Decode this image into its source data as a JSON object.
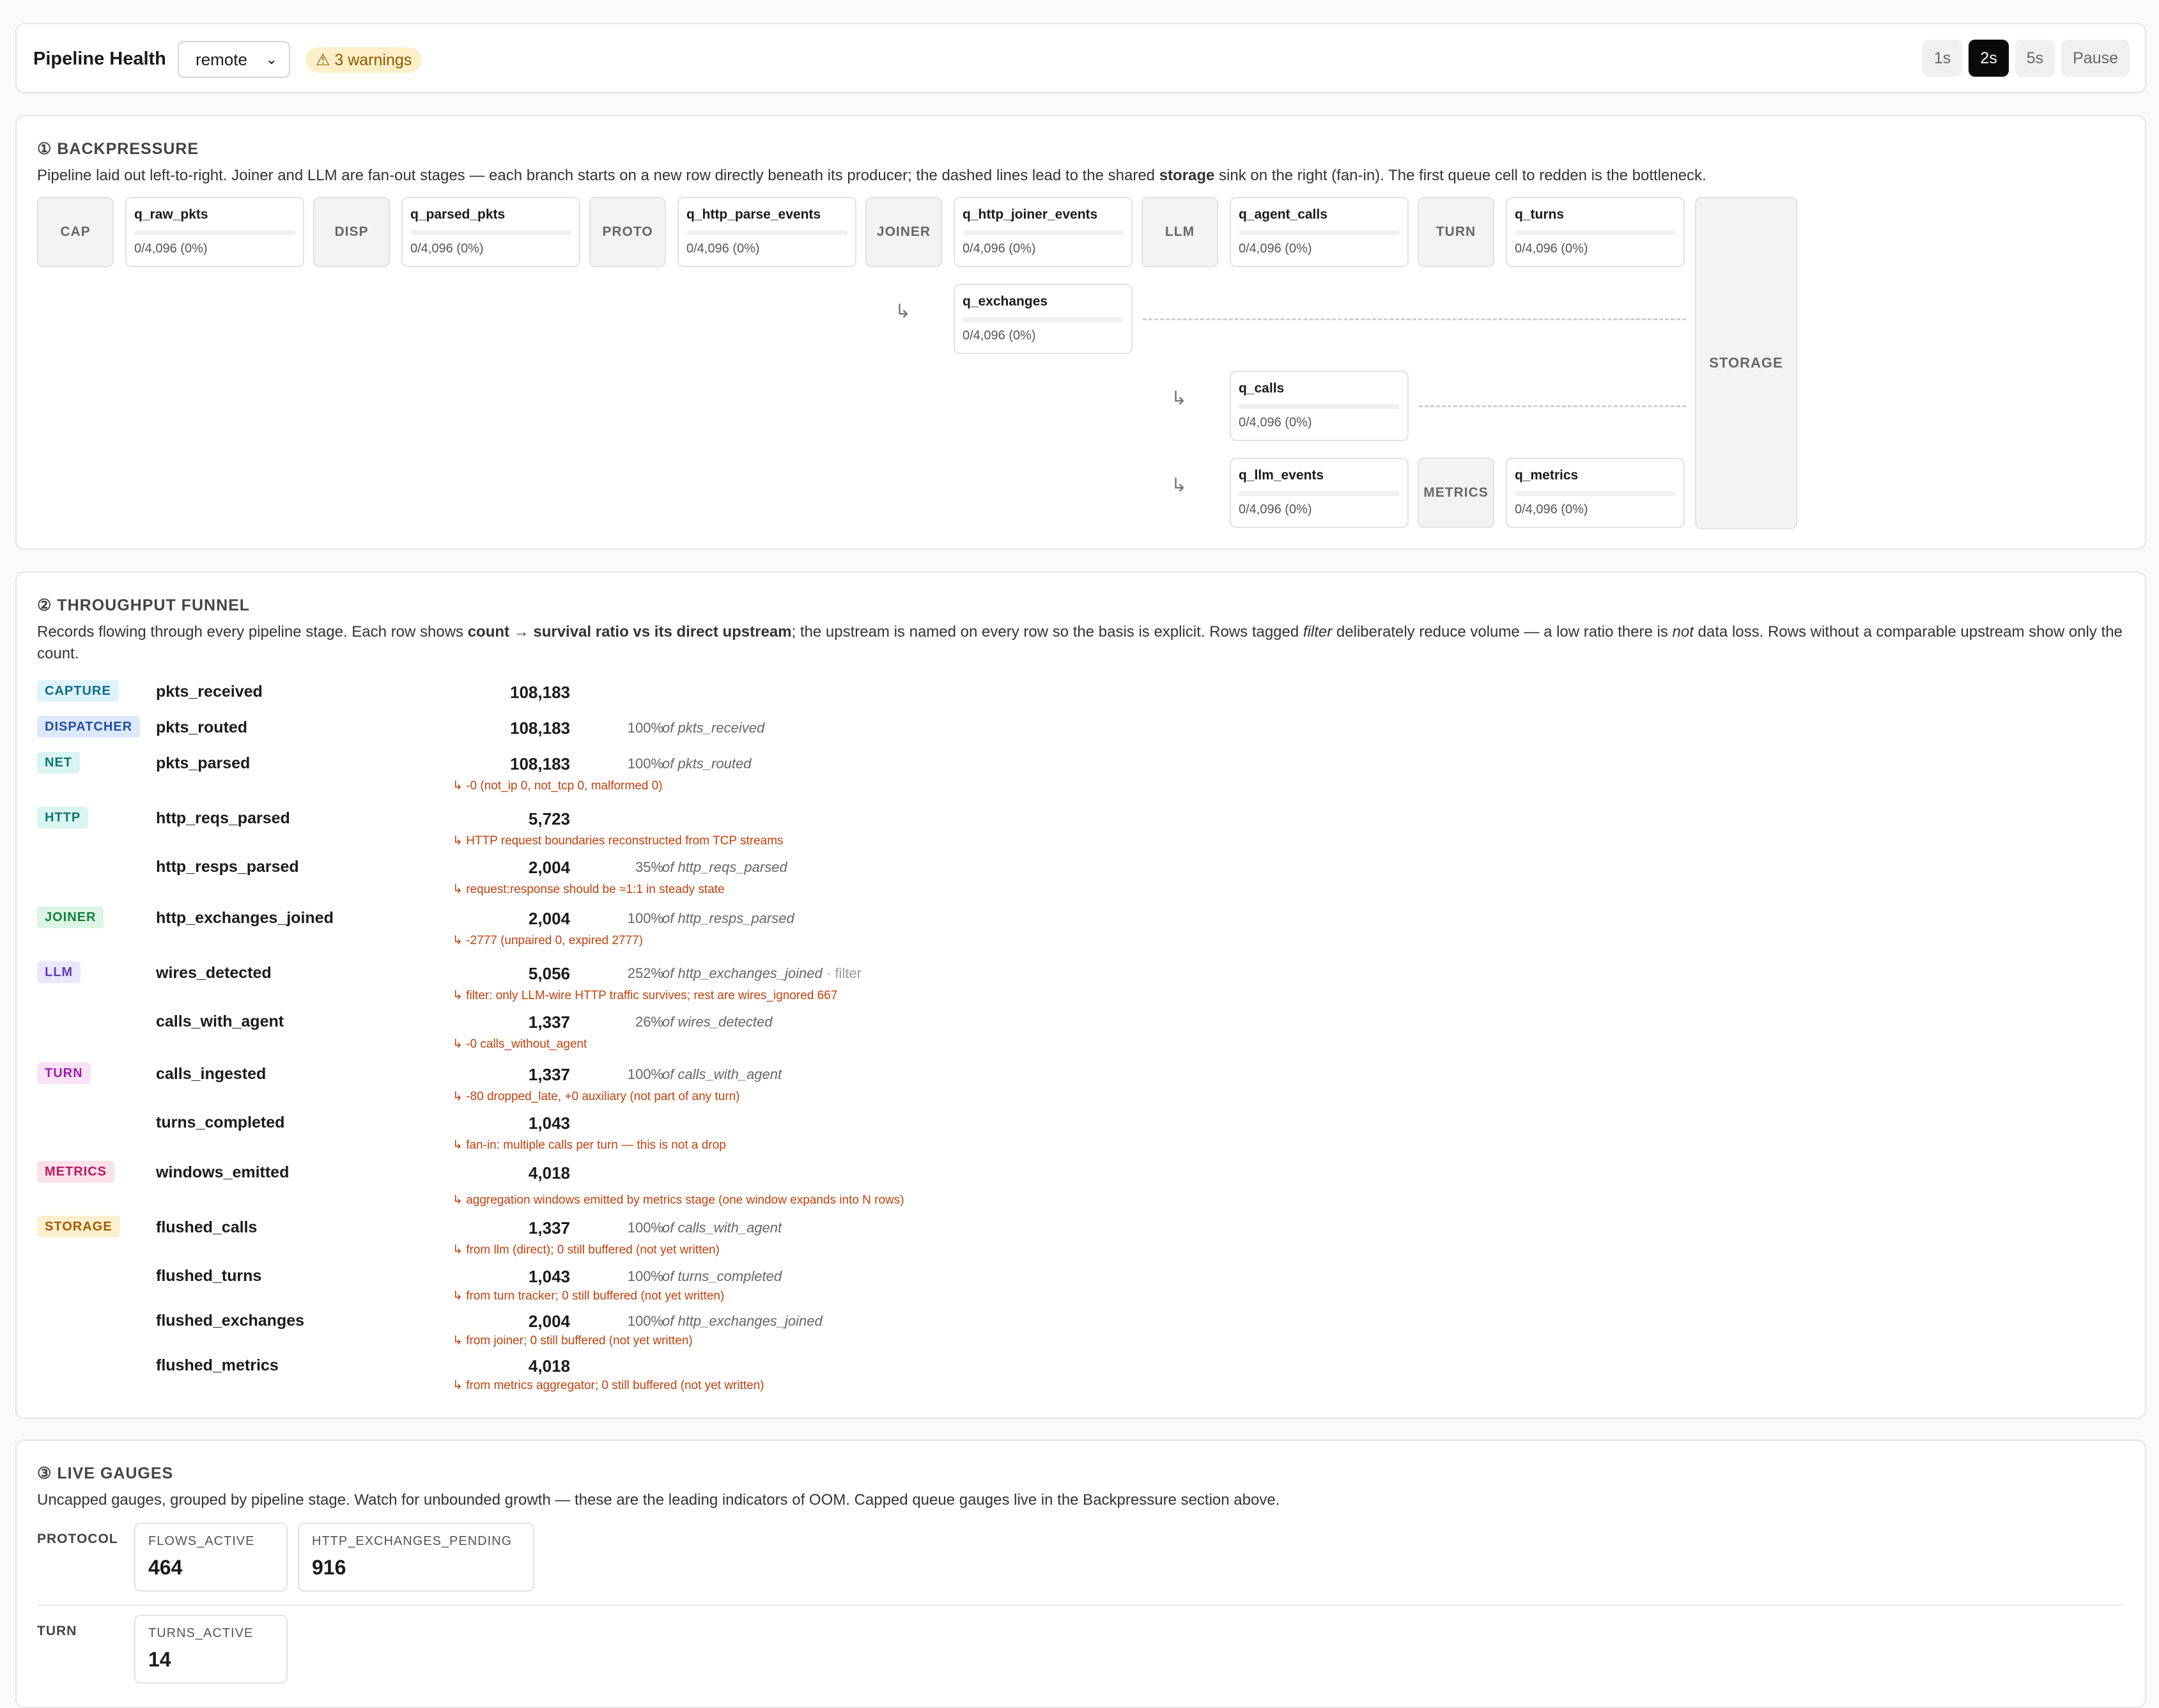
{
  "header": {
    "title": "Pipeline Health",
    "env": "remote",
    "warnings": "⚠ 3 warnings",
    "rates": [
      "1s",
      "2s",
      "5s",
      "Pause"
    ],
    "active_rate": "2s"
  },
  "backpressure": {
    "title": "① BACKPRESSURE",
    "desc_a": "Pipeline laid out left-to-right. Joiner and LLM are fan-out stages — each branch starts on a new row directly beneath its producer; the dashed lines lead to the shared ",
    "desc_b": "storage",
    "desc_c": " sink on the right (fan-in). The first queue cell to redden is the bottleneck.",
    "stages": [
      "CAP",
      "DISP",
      "PROTO",
      "JOINER",
      "LLM",
      "TURN",
      "METRICS"
    ],
    "storage": "STORAGE",
    "queues": [
      {
        "name": "q_raw_pkts",
        "value": "0/4,096 (0%)",
        "fill": 0
      },
      {
        "name": "q_parsed_pkts",
        "value": "0/4,096 (0%)",
        "fill": 0
      },
      {
        "name": "q_http_parse_events",
        "value": "0/4,096 (0%)",
        "fill": 0
      },
      {
        "name": "q_http_joiner_events",
        "value": "0/4,096 (0%)",
        "fill": 0
      },
      {
        "name": "q_agent_calls",
        "value": "0/4,096 (0%)",
        "fill": 0
      },
      {
        "name": "q_turns",
        "value": "0/4,096 (0%)",
        "fill": 0
      },
      {
        "name": "q_exchanges",
        "value": "0/4,096 (0%)",
        "fill": 0
      },
      {
        "name": "q_calls",
        "value": "0/4,096 (0%)",
        "fill": 0
      },
      {
        "name": "q_llm_events",
        "value": "0/4,096 (0%)",
        "fill": 0
      },
      {
        "name": "q_metrics",
        "value": "0/4,096 (0%)",
        "fill": 0
      }
    ],
    "branch_arrow": "↳"
  },
  "funnel": {
    "title": "② THROUGHPUT FUNNEL",
    "desc_a": "Records flowing through every pipeline stage. Each row shows ",
    "desc_b": "count → survival ratio vs its direct upstream",
    "desc_c": "; the upstream is named on every row so the basis is explicit. Rows tagged ",
    "desc_d": "filter",
    "desc_e": " deliberately reduce volume — a low ratio there is ",
    "desc_f": "not",
    "desc_g": " data loss. Rows without a comparable upstream show only the count.",
    "tags": {
      "capture": "CAPTURE",
      "dispatcher": "DISPATCHER",
      "net": "NET",
      "http": "HTTP",
      "joiner": "JOINER",
      "llm": "LLM",
      "turn": "TURN",
      "metrics": "METRICS",
      "storage": "STORAGE"
    },
    "tag_colors": {
      "capture": {
        "bg": "#dff3fb",
        "fg": "#0b6d8a"
      },
      "dispatcher": {
        "bg": "#dde8fb",
        "fg": "#1f4fa3"
      },
      "net": {
        "bg": "#d9f5f3",
        "fg": "#0f766e"
      },
      "http": {
        "bg": "#d9f5f0",
        "fg": "#0f766e"
      },
      "joiner": {
        "bg": "#dcf5e5",
        "fg": "#15803d"
      },
      "llm": {
        "bg": "#ebe6fb",
        "fg": "#5b3fb6"
      },
      "turn": {
        "bg": "#f8e3f6",
        "fg": "#a21caf"
      },
      "metrics": {
        "bg": "#fbe1ea",
        "fg": "#be185d"
      },
      "storage": {
        "bg": "#fdf0cf",
        "fg": "#a35a00"
      }
    },
    "rows": [
      {
        "name": "pkts_received",
        "count": "108,183",
        "ratio": "",
        "basis": "",
        "flag": "",
        "note": ""
      },
      {
        "name": "pkts_routed",
        "count": "108,183",
        "ratio": "100%",
        "basis": "of pkts_received",
        "flag": "",
        "note": ""
      },
      {
        "name": "pkts_parsed",
        "count": "108,183",
        "ratio": "100%",
        "basis": "of pkts_routed",
        "flag": "",
        "note": "↳ -0 (not_ip 0, not_tcp 0, malformed 0)"
      },
      {
        "name": "http_reqs_parsed",
        "count": "5,723",
        "ratio": "",
        "basis": "",
        "flag": "",
        "note": "↳ HTTP request boundaries reconstructed from TCP streams"
      },
      {
        "name": "http_resps_parsed",
        "count": "2,004",
        "ratio": "35%",
        "basis": "of http_reqs_parsed",
        "flag": "",
        "note": "↳ request:response should be ≈1:1 in steady state"
      },
      {
        "name": "http_exchanges_joined",
        "count": "2,004",
        "ratio": "100%",
        "basis": "of http_resps_parsed",
        "flag": "",
        "note": "↳ -2777 (unpaired 0, expired 2777)"
      },
      {
        "name": "wires_detected",
        "count": "5,056",
        "ratio": "252%",
        "basis": "of http_exchanges_joined",
        "flag": " · filter",
        "note": "↳ filter: only LLM-wire HTTP traffic survives; rest are wires_ignored 667"
      },
      {
        "name": "calls_with_agent",
        "count": "1,337",
        "ratio": "26%",
        "basis": "of wires_detected",
        "flag": "",
        "note": "↳ -0 calls_without_agent"
      },
      {
        "name": "calls_ingested",
        "count": "1,337",
        "ratio": "100%",
        "basis": "of calls_with_agent",
        "flag": "",
        "note": "↳ -80 dropped_late, +0 auxiliary (not part of any turn)"
      },
      {
        "name": "turns_completed",
        "count": "1,043",
        "ratio": "",
        "basis": "",
        "flag": "",
        "note": "↳ fan-in: multiple calls per turn — this is not a drop"
      },
      {
        "name": "windows_emitted",
        "count": "4,018",
        "ratio": "",
        "basis": "",
        "flag": "",
        "note": "↳ aggregation windows emitted by metrics stage (one window expands into N rows)"
      },
      {
        "name": "flushed_calls",
        "count": "1,337",
        "ratio": "100%",
        "basis": "of calls_with_agent",
        "flag": "",
        "note": "↳ from llm (direct); 0 still buffered (not yet written)"
      },
      {
        "name": "flushed_turns",
        "count": "1,043",
        "ratio": "100%",
        "basis": "of turns_completed",
        "flag": "",
        "note": "↳ from turn tracker; 0 still buffered (not yet written)"
      },
      {
        "name": "flushed_exchanges",
        "count": "2,004",
        "ratio": "100%",
        "basis": "of http_exchanges_joined",
        "flag": "",
        "note": "↳ from joiner; 0 still buffered (not yet written)"
      },
      {
        "name": "flushed_metrics",
        "count": "4,018",
        "ratio": "",
        "basis": "",
        "flag": "",
        "note": "↳ from metrics aggregator; 0 still buffered (not yet written)"
      }
    ]
  },
  "gauges": {
    "title": "③ LIVE GAUGES",
    "desc": "Uncapped gauges, grouped by pipeline stage. Watch for unbounded growth — these are the leading indicators of OOM. Capped queue gauges live in the Backpressure section above.",
    "groups": [
      {
        "label": "PROTOCOL",
        "items": [
          {
            "name": "FLOWS_ACTIVE",
            "value": "464"
          },
          {
            "name": "HTTP_EXCHANGES_PENDING",
            "value": "916"
          }
        ]
      },
      {
        "label": "TURN",
        "items": [
          {
            "name": "TURNS_ACTIVE",
            "value": "14"
          }
        ]
      }
    ]
  }
}
